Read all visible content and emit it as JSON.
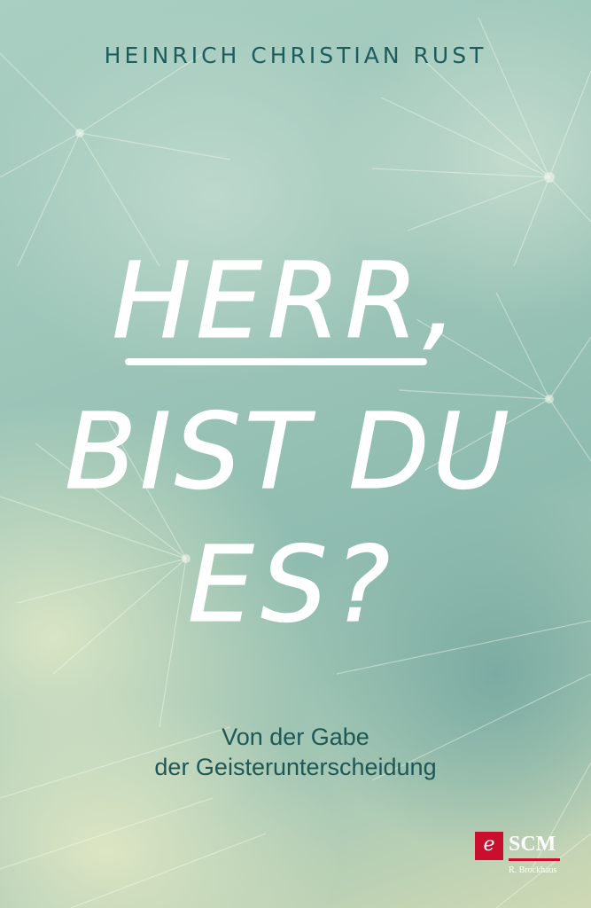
{
  "cover": {
    "author": "HEINRICH CHRISTIAN RUST",
    "title_lines": [
      "HERR,",
      "BIST DU",
      "ES?"
    ],
    "subtitle_lines": [
      "Von der Gabe",
      "der Geisterunterscheidung"
    ],
    "publisher": {
      "mark": "e",
      "name": "SCM",
      "imprint": "R. Brockhaus"
    }
  },
  "colors": {
    "author_text": "#1e5d5b",
    "subtitle_text": "#1f5755",
    "title_text": "#ffffff",
    "publisher_red": "#c8102e",
    "background": "#9cc5b8"
  }
}
